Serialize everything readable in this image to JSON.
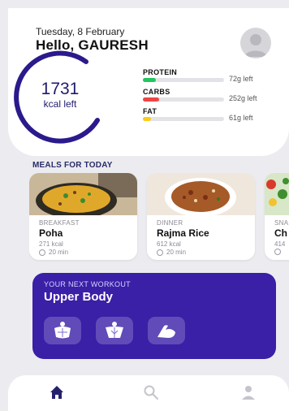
{
  "header": {
    "date": "Tuesday, 8 February",
    "greeting": "Hello, GAURESH"
  },
  "calories": {
    "value": "1731",
    "label": "kcal left",
    "ring_color": "#2a1a8c"
  },
  "macros": [
    {
      "name": "PROTEIN",
      "left": "72g left",
      "fill_fraction": 0.16,
      "color": "#22c55e"
    },
    {
      "name": "CARBS",
      "left": "252g left",
      "fill_fraction": 0.2,
      "color": "#ef4444"
    },
    {
      "name": "FAT",
      "left": "61g left",
      "fill_fraction": 0.1,
      "color": "#facc15"
    }
  ],
  "meals_section": {
    "title": "MEALS FOR TODAY",
    "meals": [
      {
        "type": "BREAKFAST",
        "name": "Poha",
        "kcal": "271 kcal",
        "time": "20 min"
      },
      {
        "type": "DINNER",
        "name": "Rajma Rice",
        "kcal": "612 kcal",
        "time": "20 min"
      },
      {
        "type": "SNA",
        "name": "Ch",
        "kcal": "414",
        "time": ""
      }
    ]
  },
  "workout": {
    "eyebrow": "YOUR NEXT WORKOUT",
    "title": "Upper Body",
    "exercises": [
      {
        "icon": "chest-icon"
      },
      {
        "icon": "back-icon"
      },
      {
        "icon": "biceps-icon"
      }
    ],
    "color": "#3a1fa7"
  },
  "nav": [
    {
      "icon": "home-icon",
      "active": true
    },
    {
      "icon": "search-icon",
      "active": false
    },
    {
      "icon": "profile-icon",
      "active": false
    }
  ]
}
